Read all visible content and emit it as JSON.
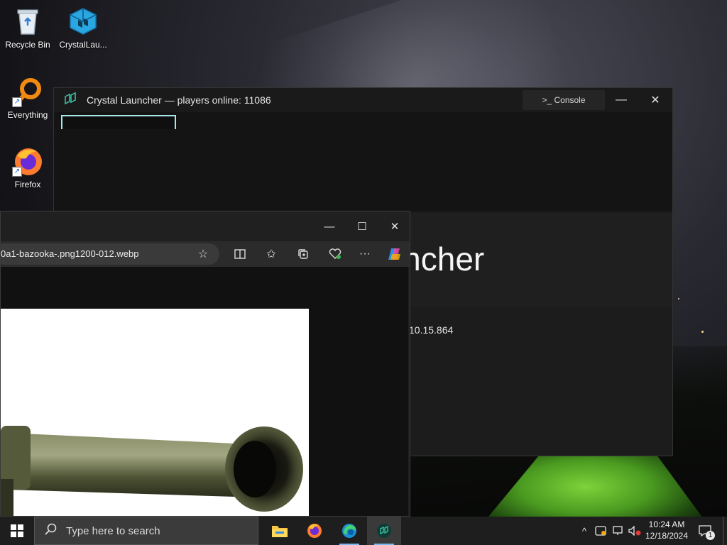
{
  "desktop": {
    "icons": [
      {
        "label": "Recycle Bin"
      },
      {
        "label": "CrystalLau..."
      },
      {
        "label": "Everything"
      },
      {
        "label": "Firefox"
      }
    ]
  },
  "crystal_window": {
    "title": "Crystal Launcher — players online: 11086",
    "console_label": ">_ Console",
    "brand_text": "auncher",
    "version_text": "10.15.864",
    "minimize": "—",
    "close": "✕"
  },
  "browser_window": {
    "url": "0a1-bazooka-.png1200-012.webp",
    "minimize": "—",
    "maximize": "☐",
    "close": "✕"
  },
  "taskbar": {
    "search_placeholder": "Type here to search",
    "clock_time": "10:24 AM",
    "clock_date": "12/18/2024",
    "notification_count": "1"
  },
  "colors": {
    "accent": "#76b9ed",
    "crystal_cyan": "#a8e6ea",
    "tent_green": "#6cc532"
  }
}
